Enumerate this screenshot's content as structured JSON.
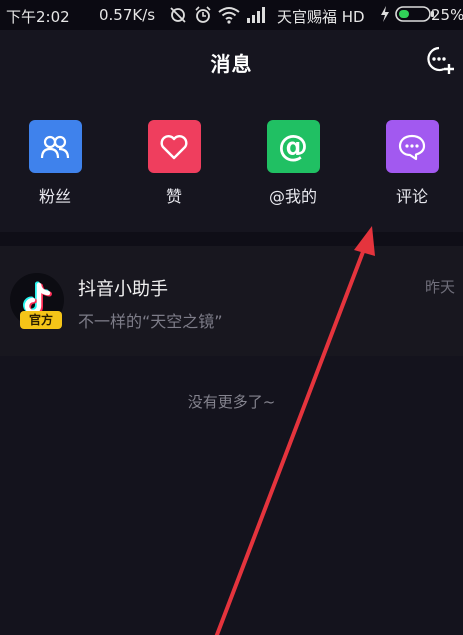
{
  "status_bar": {
    "time": "下午2:02",
    "speed": "0.57K/s",
    "carrier": "天官赐福 HD",
    "battery": "25%"
  },
  "header": {
    "title": "消息",
    "compose_icon": "new-chat-icon"
  },
  "shortcuts": [
    {
      "label": "粉丝",
      "icon": "fans-icon",
      "color": "#3f82ec"
    },
    {
      "label": "赞",
      "icon": "heart-icon",
      "color": "#ef3e5e"
    },
    {
      "label": "@我的",
      "icon": "at-icon",
      "color": "#20c063"
    },
    {
      "label": "评论",
      "icon": "comment-icon",
      "color": "#a259f0"
    }
  ],
  "messages": [
    {
      "name": "抖音小助手",
      "preview": "不一样的“天空之镜”",
      "date": "昨天",
      "badge": "官方"
    }
  ],
  "footer_text": "没有更多了~",
  "annotation": {
    "arrow_color": "#e5343d"
  }
}
